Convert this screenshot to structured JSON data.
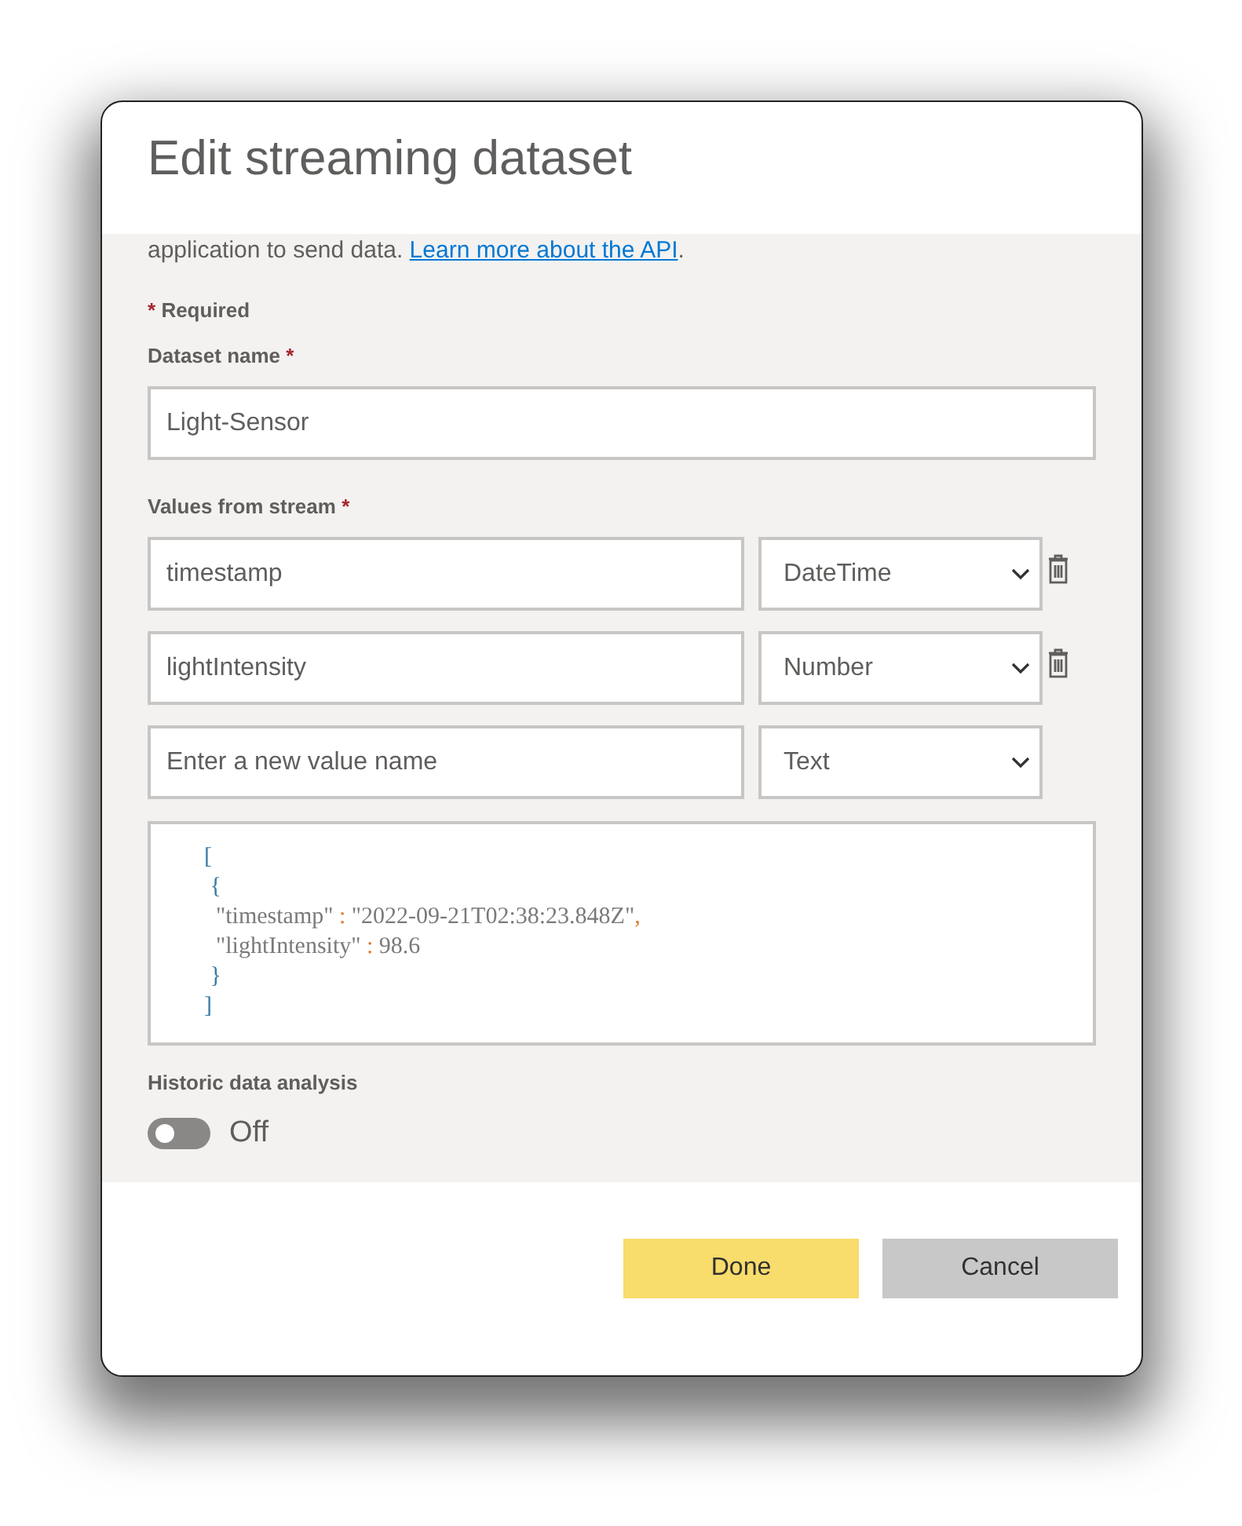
{
  "dialog": {
    "title": "Edit streaming dataset",
    "intro": {
      "text": "application to send data.",
      "link": "Learn more about the API",
      "after": "."
    },
    "required_note": {
      "mark": "*",
      "text": "Required"
    },
    "dataset_name": {
      "label": "Dataset name",
      "mark": "*",
      "value": "Light-Sensor"
    },
    "values": {
      "label": "Values from stream",
      "mark": "*",
      "rows": [
        {
          "name": "timestamp",
          "type": "DateTime",
          "deletable": true
        },
        {
          "name": "lightIntensity",
          "type": "Number",
          "deletable": true
        },
        {
          "placeholder": "Enter a new value name",
          "type": "Text",
          "deletable": false
        }
      ]
    },
    "sample": [
      [
        {
          "kind": "bracket",
          "text": "["
        }
      ],
      [
        {
          "kind": "bracket",
          "text": " {"
        }
      ],
      [
        {
          "kind": "key",
          "text": "  \"timestamp\""
        },
        {
          "kind": "colon",
          "text": " : "
        },
        {
          "kind": "value",
          "text": "\"2022-09-21T02:38:23.848Z\""
        },
        {
          "kind": "colon",
          "text": ","
        }
      ],
      [
        {
          "kind": "key",
          "text": "  \"lightIntensity\""
        },
        {
          "kind": "colon",
          "text": " : "
        },
        {
          "kind": "value",
          "text": "98.6"
        }
      ],
      [
        {
          "kind": "bracket",
          "text": " }"
        }
      ],
      [
        {
          "kind": "bracket",
          "text": "]"
        }
      ]
    ],
    "historic": {
      "label": "Historic data analysis",
      "on": false,
      "state_text": "Off"
    },
    "buttons": [
      {
        "label": "Done",
        "kind": "primary"
      },
      {
        "label": "Cancel",
        "kind": "secondary"
      }
    ]
  }
}
